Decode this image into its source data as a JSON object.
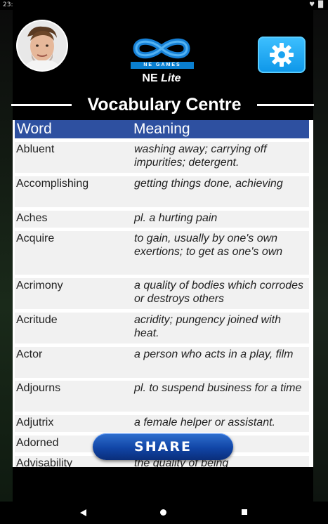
{
  "status_bar": {
    "time": "23:",
    "icons": "♥ █"
  },
  "header": {
    "logo_text": "NE GAMES",
    "app_name": "NE",
    "app_name_suffix": "Lite"
  },
  "page": {
    "title": "Vocabulary Centre"
  },
  "table": {
    "columns": [
      "Word",
      "Meaning"
    ],
    "rows": [
      {
        "word": "Abluent",
        "meaning": "washing away; carrying off impurities; detergent."
      },
      {
        "word": "Accomplishing",
        "meaning": "getting things done, achieving"
      },
      {
        "word": "Aches",
        "meaning": "pl. a hurting pain"
      },
      {
        "word": "Acquire",
        "meaning": "to gain, usually by one's own exertions; to get as one's own"
      },
      {
        "word": "Acrimony",
        "meaning": "a quality of bodies which corrodes or destroys others"
      },
      {
        "word": "Acritude",
        "meaning": "acridity; pungency joined with heat."
      },
      {
        "word": "Actor",
        "meaning": "a person who acts in a play, film"
      },
      {
        "word": "Adjourns",
        "meaning": "pl. to suspend business for a time"
      },
      {
        "word": "Adjutrix",
        "meaning": "a female helper or assistant."
      },
      {
        "word": "Adorned",
        "meaning": ""
      },
      {
        "word": "Advisability",
        "meaning": "the quality of being"
      }
    ]
  },
  "share_button": {
    "label": "SHARE"
  },
  "icons": {
    "settings": "gear-icon",
    "back": "back-triangle-icon",
    "home": "home-circle-icon",
    "recents": "recents-square-icon"
  },
  "colors": {
    "header_blue": "#2e50a0",
    "settings_blue": "#1aa3f0",
    "share_blue": "#1145a6"
  }
}
